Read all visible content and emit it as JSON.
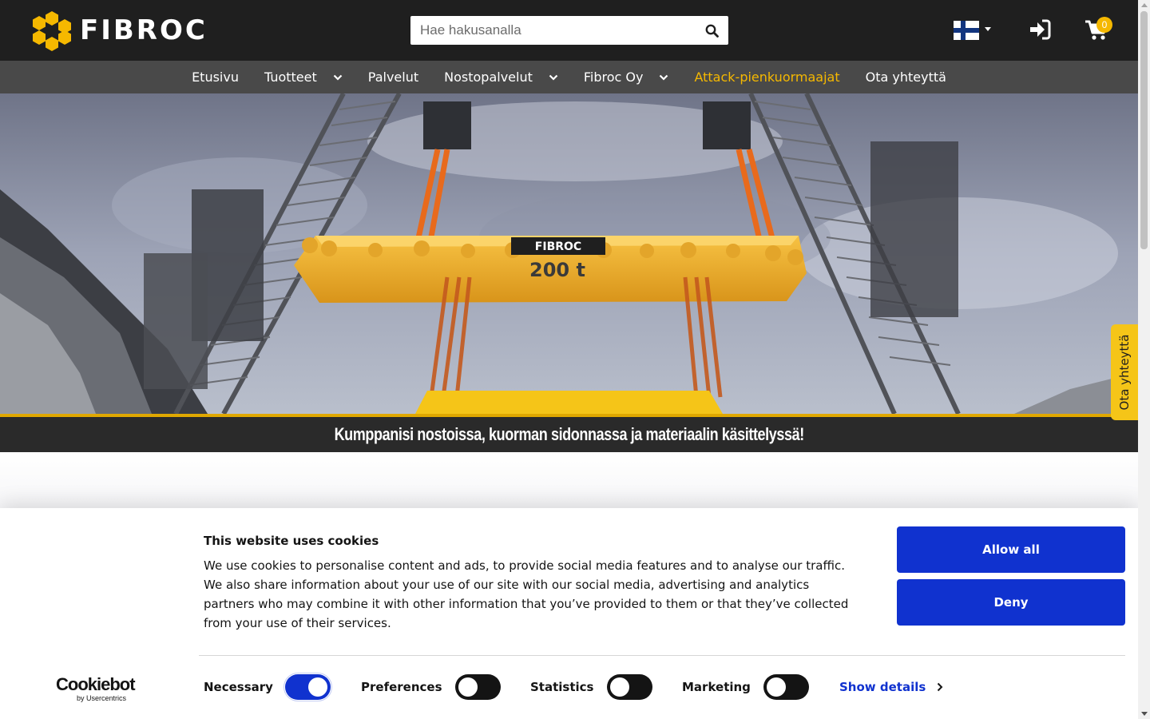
{
  "header": {
    "logo_text": "FIBROC",
    "search": {
      "placeholder": "Hae hakusanalla"
    },
    "language": {
      "current": "fi",
      "icon": "finland-flag-icon"
    },
    "login_icon": "sign-in-icon",
    "cart": {
      "icon": "shopping-cart-icon",
      "count": "0"
    }
  },
  "nav": {
    "items": [
      {
        "label": "Etusivu",
        "dropdown": false
      },
      {
        "label": "Tuotteet",
        "dropdown": true
      },
      {
        "label": "Palvelut",
        "dropdown": false
      },
      {
        "label": "Nostopalvelut",
        "dropdown": true
      },
      {
        "label": "Fibroc Oy",
        "dropdown": true
      },
      {
        "label": "Attack-pienkuormaajat",
        "dropdown": false,
        "highlight": true
      },
      {
        "label": "Ota yhteyttä",
        "dropdown": false
      }
    ]
  },
  "hero": {
    "beam_logo": "FIBROC",
    "beam_capacity": "200 t",
    "tagline": "Kumppanisi nostoissa, kuorman sidonnassa ja materiaalin käsittelyssä!"
  },
  "contact_tab": {
    "label": "Ota yhteyttä"
  },
  "cookie_banner": {
    "title": "This website uses cookies",
    "text": "We use cookies to personalise content and ads, to provide social media features and to analyse our traffic. We also share information about your use of our site with our social media, advertising and analytics partners who may combine it with other information that you’ve provided to them or that they’ve collected from your use of their services.",
    "allow_all": "Allow all",
    "deny": "Deny",
    "brand": {
      "name": "Cookiebot",
      "sub": "by Usercentrics"
    },
    "toggles": [
      {
        "label": "Necessary",
        "on": true
      },
      {
        "label": "Preferences",
        "on": false
      },
      {
        "label": "Statistics",
        "on": false
      },
      {
        "label": "Marketing",
        "on": false
      }
    ],
    "show_details": "Show details"
  },
  "colors": {
    "header_bg": "#1f1f1f",
    "nav_bg": "#494949",
    "accent_yellow": "#f5b800",
    "cookie_blue": "#1032cf"
  }
}
